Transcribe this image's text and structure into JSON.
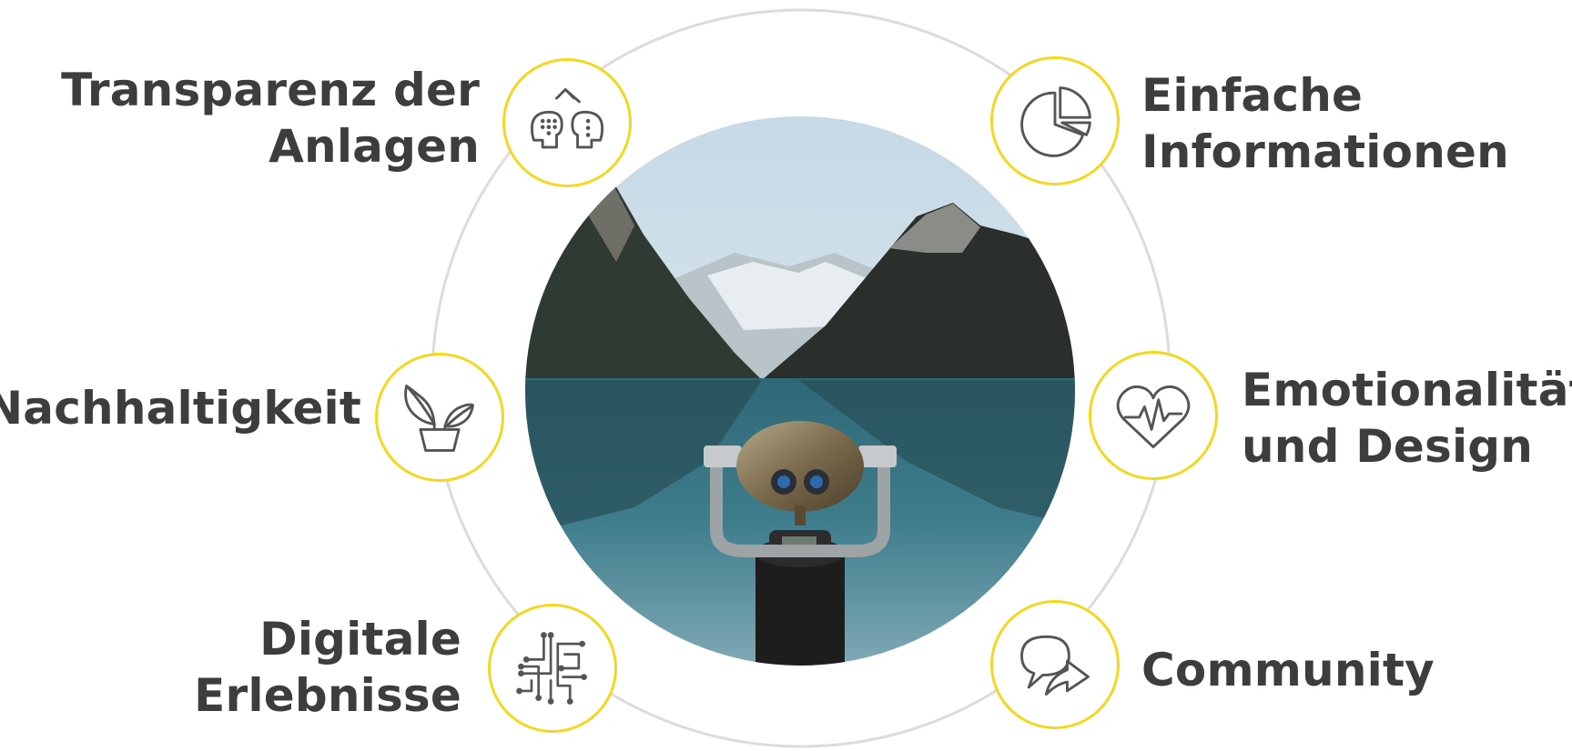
{
  "items": [
    {
      "id": "transparenz",
      "lines": [
        "Transparenz der",
        "Anlagen"
      ],
      "icon": "brain-exchange-icon"
    },
    {
      "id": "einfache",
      "lines": [
        "Einfache",
        "Informationen"
      ],
      "icon": "pie-chart-icon"
    },
    {
      "id": "nachhaltigkeit",
      "lines": [
        "Nachhaltigkeit"
      ],
      "icon": "plant-pot-icon"
    },
    {
      "id": "emotionalitaet",
      "lines": [
        "Emotionalität",
        "und Design"
      ],
      "icon": "heartbeat-icon"
    },
    {
      "id": "digitale",
      "lines": [
        "Digitale",
        "Erlebnisse"
      ],
      "icon": "circuit-icon"
    },
    {
      "id": "community",
      "lines": [
        "Community"
      ],
      "icon": "speech-bubbles-icon"
    }
  ],
  "center_image": "mountain-lake-binoculars-photo",
  "colors": {
    "accent": "#f2d820",
    "text": "#3d3d3d",
    "ring": "#d9d9d9",
    "icon": "#555555"
  }
}
